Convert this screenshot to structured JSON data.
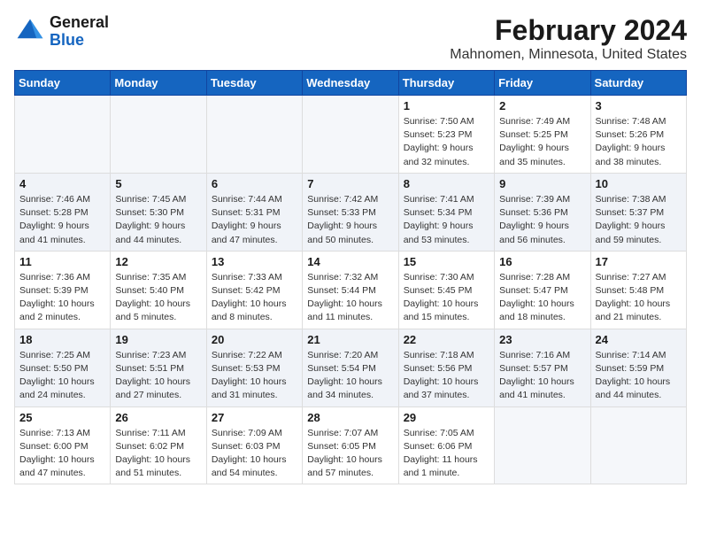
{
  "header": {
    "logo_text_top": "General",
    "logo_text_bottom": "Blue",
    "title": "February 2024",
    "subtitle": "Mahnomen, Minnesota, United States"
  },
  "days_of_week": [
    "Sunday",
    "Monday",
    "Tuesday",
    "Wednesday",
    "Thursday",
    "Friday",
    "Saturday"
  ],
  "weeks": [
    [
      {
        "day": "",
        "info": ""
      },
      {
        "day": "",
        "info": ""
      },
      {
        "day": "",
        "info": ""
      },
      {
        "day": "",
        "info": ""
      },
      {
        "day": "1",
        "info": "Sunrise: 7:50 AM\nSunset: 5:23 PM\nDaylight: 9 hours and 32 minutes."
      },
      {
        "day": "2",
        "info": "Sunrise: 7:49 AM\nSunset: 5:25 PM\nDaylight: 9 hours and 35 minutes."
      },
      {
        "day": "3",
        "info": "Sunrise: 7:48 AM\nSunset: 5:26 PM\nDaylight: 9 hours and 38 minutes."
      }
    ],
    [
      {
        "day": "4",
        "info": "Sunrise: 7:46 AM\nSunset: 5:28 PM\nDaylight: 9 hours and 41 minutes."
      },
      {
        "day": "5",
        "info": "Sunrise: 7:45 AM\nSunset: 5:30 PM\nDaylight: 9 hours and 44 minutes."
      },
      {
        "day": "6",
        "info": "Sunrise: 7:44 AM\nSunset: 5:31 PM\nDaylight: 9 hours and 47 minutes."
      },
      {
        "day": "7",
        "info": "Sunrise: 7:42 AM\nSunset: 5:33 PM\nDaylight: 9 hours and 50 minutes."
      },
      {
        "day": "8",
        "info": "Sunrise: 7:41 AM\nSunset: 5:34 PM\nDaylight: 9 hours and 53 minutes."
      },
      {
        "day": "9",
        "info": "Sunrise: 7:39 AM\nSunset: 5:36 PM\nDaylight: 9 hours and 56 minutes."
      },
      {
        "day": "10",
        "info": "Sunrise: 7:38 AM\nSunset: 5:37 PM\nDaylight: 9 hours and 59 minutes."
      }
    ],
    [
      {
        "day": "11",
        "info": "Sunrise: 7:36 AM\nSunset: 5:39 PM\nDaylight: 10 hours and 2 minutes."
      },
      {
        "day": "12",
        "info": "Sunrise: 7:35 AM\nSunset: 5:40 PM\nDaylight: 10 hours and 5 minutes."
      },
      {
        "day": "13",
        "info": "Sunrise: 7:33 AM\nSunset: 5:42 PM\nDaylight: 10 hours and 8 minutes."
      },
      {
        "day": "14",
        "info": "Sunrise: 7:32 AM\nSunset: 5:44 PM\nDaylight: 10 hours and 11 minutes."
      },
      {
        "day": "15",
        "info": "Sunrise: 7:30 AM\nSunset: 5:45 PM\nDaylight: 10 hours and 15 minutes."
      },
      {
        "day": "16",
        "info": "Sunrise: 7:28 AM\nSunset: 5:47 PM\nDaylight: 10 hours and 18 minutes."
      },
      {
        "day": "17",
        "info": "Sunrise: 7:27 AM\nSunset: 5:48 PM\nDaylight: 10 hours and 21 minutes."
      }
    ],
    [
      {
        "day": "18",
        "info": "Sunrise: 7:25 AM\nSunset: 5:50 PM\nDaylight: 10 hours and 24 minutes."
      },
      {
        "day": "19",
        "info": "Sunrise: 7:23 AM\nSunset: 5:51 PM\nDaylight: 10 hours and 27 minutes."
      },
      {
        "day": "20",
        "info": "Sunrise: 7:22 AM\nSunset: 5:53 PM\nDaylight: 10 hours and 31 minutes."
      },
      {
        "day": "21",
        "info": "Sunrise: 7:20 AM\nSunset: 5:54 PM\nDaylight: 10 hours and 34 minutes."
      },
      {
        "day": "22",
        "info": "Sunrise: 7:18 AM\nSunset: 5:56 PM\nDaylight: 10 hours and 37 minutes."
      },
      {
        "day": "23",
        "info": "Sunrise: 7:16 AM\nSunset: 5:57 PM\nDaylight: 10 hours and 41 minutes."
      },
      {
        "day": "24",
        "info": "Sunrise: 7:14 AM\nSunset: 5:59 PM\nDaylight: 10 hours and 44 minutes."
      }
    ],
    [
      {
        "day": "25",
        "info": "Sunrise: 7:13 AM\nSunset: 6:00 PM\nDaylight: 10 hours and 47 minutes."
      },
      {
        "day": "26",
        "info": "Sunrise: 7:11 AM\nSunset: 6:02 PM\nDaylight: 10 hours and 51 minutes."
      },
      {
        "day": "27",
        "info": "Sunrise: 7:09 AM\nSunset: 6:03 PM\nDaylight: 10 hours and 54 minutes."
      },
      {
        "day": "28",
        "info": "Sunrise: 7:07 AM\nSunset: 6:05 PM\nDaylight: 10 hours and 57 minutes."
      },
      {
        "day": "29",
        "info": "Sunrise: 7:05 AM\nSunset: 6:06 PM\nDaylight: 11 hours and 1 minute."
      },
      {
        "day": "",
        "info": ""
      },
      {
        "day": "",
        "info": ""
      }
    ]
  ]
}
